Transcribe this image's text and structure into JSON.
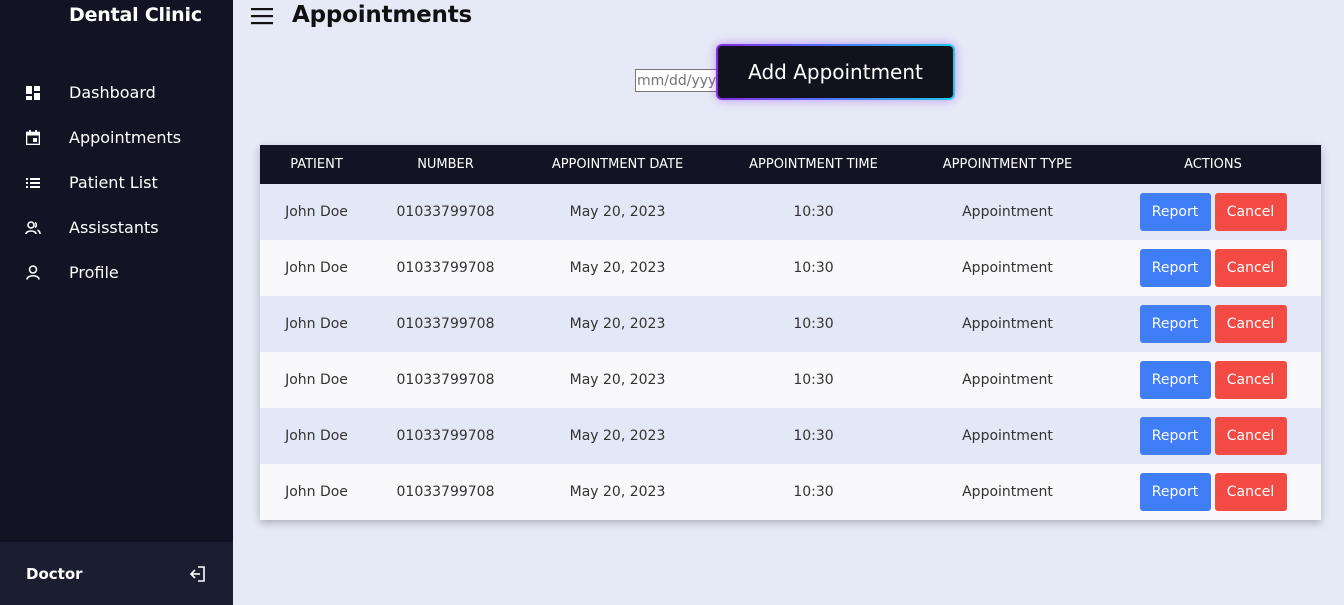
{
  "app": {
    "brand": "Dental Clinic"
  },
  "sidebar": {
    "items": [
      {
        "label": "Dashboard",
        "icon": "dashboard-icon"
      },
      {
        "label": "Appointments",
        "icon": "calendar-icon"
      },
      {
        "label": "Patient List",
        "icon": "list-icon"
      },
      {
        "label": "Assisstants",
        "icon": "users-icon"
      },
      {
        "label": "Profile",
        "icon": "user-icon"
      }
    ],
    "footer": {
      "user": "Doctor",
      "icon": "logout-icon"
    }
  },
  "header": {
    "title": "Appointments",
    "menu_icon": "hamburger-icon"
  },
  "toolbar": {
    "date_placeholder": "mm/dd/yyyy",
    "add_button": "Add Appointment"
  },
  "table": {
    "columns": [
      "PATIENT",
      "NUMBER",
      "APPOINTMENT DATE",
      "APPOINTMENT TIME",
      "APPOINTMENT TYPE",
      "ACTIONS"
    ],
    "rows": [
      {
        "patient": "John Doe",
        "number": "01033799708",
        "date": "May 20, 2023",
        "time": "10:30",
        "type": "Appointment",
        "report": "Report",
        "cancel": "Cancel"
      },
      {
        "patient": "John Doe",
        "number": "01033799708",
        "date": "May 20, 2023",
        "time": "10:30",
        "type": "Appointment",
        "report": "Report",
        "cancel": "Cancel"
      },
      {
        "patient": "John Doe",
        "number": "01033799708",
        "date": "May 20, 2023",
        "time": "10:30",
        "type": "Appointment",
        "report": "Report",
        "cancel": "Cancel"
      },
      {
        "patient": "John Doe",
        "number": "01033799708",
        "date": "May 20, 2023",
        "time": "10:30",
        "type": "Appointment",
        "report": "Report",
        "cancel": "Cancel"
      },
      {
        "patient": "John Doe",
        "number": "01033799708",
        "date": "May 20, 2023",
        "time": "10:30",
        "type": "Appointment",
        "report": "Report",
        "cancel": "Cancel"
      },
      {
        "patient": "John Doe",
        "number": "01033799708",
        "date": "May 20, 2023",
        "time": "10:30",
        "type": "Appointment",
        "report": "Report",
        "cancel": "Cancel"
      }
    ]
  },
  "colors": {
    "sidebar_bg": "#121424",
    "page_bg": "#e6eaf7",
    "report_button": "#3f7ef6",
    "cancel_button": "#f44a44"
  }
}
